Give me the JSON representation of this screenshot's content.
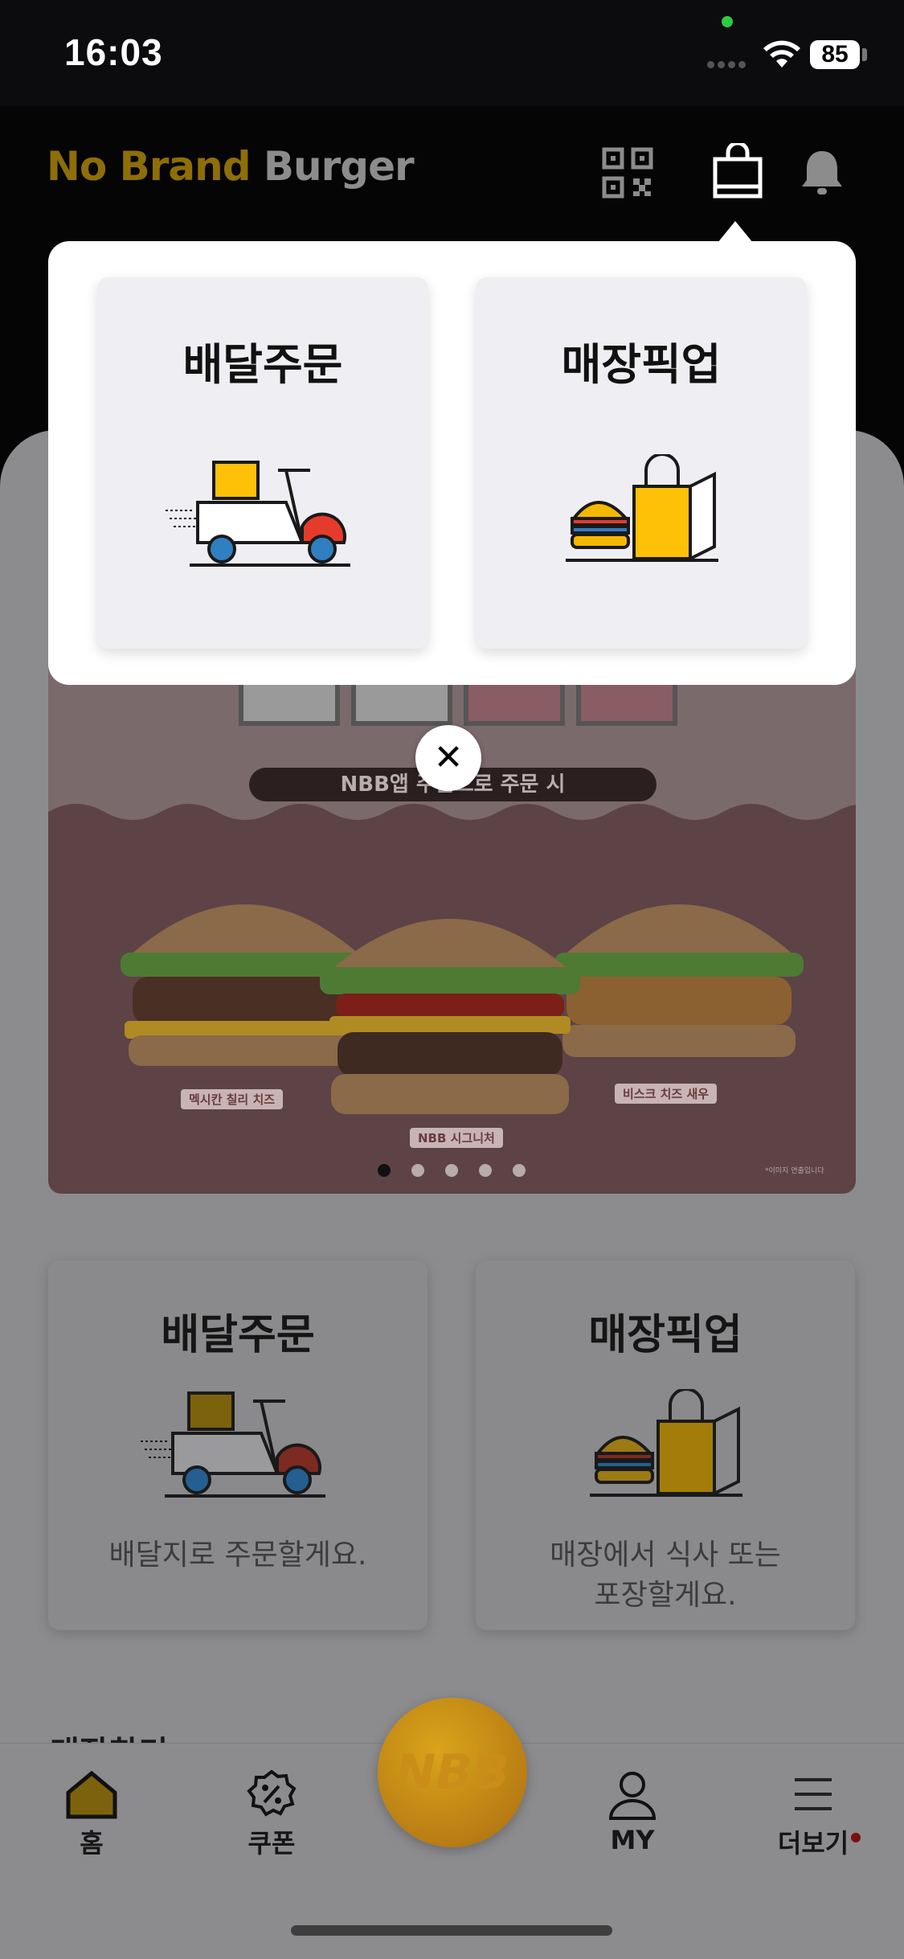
{
  "status_bar": {
    "time": "16:03",
    "battery": "85"
  },
  "header": {
    "logo_no_brand": "No Brand",
    "logo_burger": "Burger"
  },
  "banner": {
    "tag": "NBB앱 주문으로 주문 시",
    "burgers": [
      "멕시칸 칠리 치즈",
      "NBB 시그니처",
      "비스크 치즈 새우"
    ],
    "disclaimer": "*이미지 연출입니다"
  },
  "popup": {
    "delivery_title": "배달주문",
    "pickup_title": "매장픽업"
  },
  "order_cards": {
    "delivery_title": "배달주문",
    "delivery_desc": "배달지로 주문할게요.",
    "pickup_title": "매장픽업",
    "pickup_desc_line1": "매장에서 식사 또는",
    "pickup_desc_line2": "포장할게요."
  },
  "partial_heading": "매장찾기",
  "bottom_nav": {
    "home": "홈",
    "coupon": "쿠폰",
    "center": "NBB",
    "my": "MY",
    "more": "더보기"
  },
  "colors": {
    "brand_yellow": "#f5b800",
    "overlay_dim": "#8c8c8e",
    "bag_yellow": "#ffc107",
    "scooter_red": "#e53b2c",
    "wheel_blue": "#2f7fc1"
  }
}
